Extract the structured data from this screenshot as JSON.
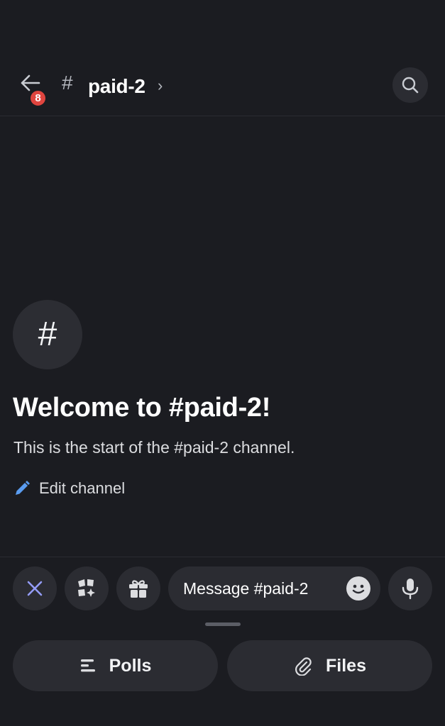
{
  "header": {
    "back_badge_count": "8",
    "channel_prefix": "#",
    "channel_name": "paid-2",
    "chevron": "›"
  },
  "welcome": {
    "avatar_glyph": "#",
    "title": "Welcome to #paid-2!",
    "subtitle": "This is the start of the #paid-2 channel.",
    "edit_label": "Edit channel"
  },
  "composer": {
    "placeholder": "Message #paid-2"
  },
  "bottom": {
    "polls_label": "Polls",
    "files_label": "Files"
  },
  "icons": {
    "back": "back-arrow-icon",
    "search": "search-icon",
    "edit": "pencil-icon",
    "close": "close-icon",
    "apps": "apps-icon",
    "gift": "gift-icon",
    "emoji": "emoji-icon",
    "mic": "microphone-icon",
    "polls": "polls-icon",
    "files": "paperclip-icon"
  },
  "colors": {
    "background": "#1b1c21",
    "surface": "#2b2c32",
    "badge": "#e0453f",
    "accent_close": "#949cf7",
    "pencil": "#5a9cf0"
  }
}
